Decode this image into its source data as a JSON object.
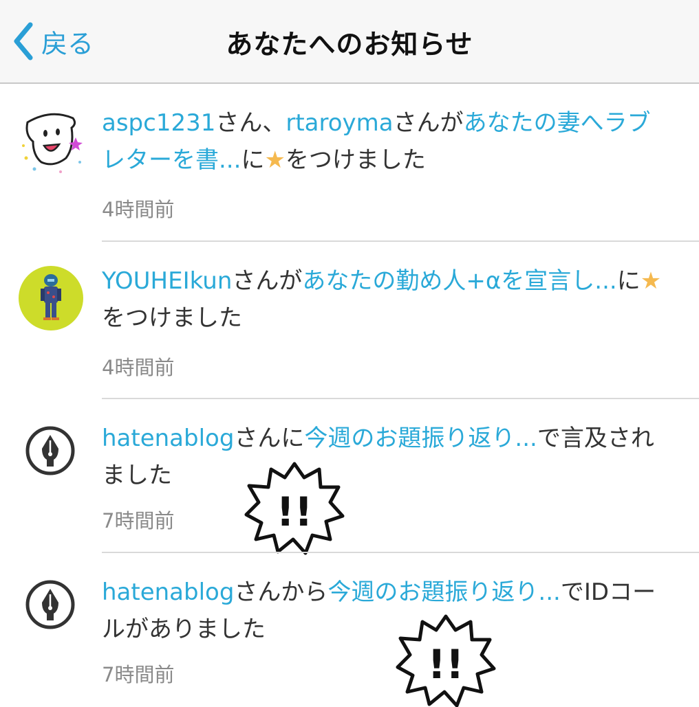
{
  "nav": {
    "back_label": "戻る",
    "title": "あなたへのお知らせ"
  },
  "colors": {
    "link": "#2aa9d8",
    "star": "#f5b94f",
    "text": "#333333",
    "time": "#8a8a8a"
  },
  "notifications": [
    {
      "avatar": "cartoon-face-icon",
      "user1": "aspc1231",
      "join1": "さん、",
      "user2": "rtaroyma",
      "join2": "さんが",
      "entry": "あなたの妻へラブレターを書...",
      "pre_star": "に",
      "star": "★",
      "suffix": "をつけました",
      "time": "4時間前"
    },
    {
      "avatar": "character-avatar-icon",
      "user1": "YOUHEIkun",
      "join1": "さんが",
      "entry": "あなたの勤め人+αを宣言し...",
      "pre_star": "に",
      "star": "★",
      "suffix": "をつけました",
      "time": "4時間前"
    },
    {
      "avatar": "pen-nib-icon",
      "user1": "hatenablog",
      "join1": "さんに",
      "entry": "今週のお題振り返り...",
      "suffix": "で言及されました",
      "time": "7時間前",
      "sticker": "!!"
    },
    {
      "avatar": "pen-nib-icon",
      "user1": "hatenablog",
      "join1": "さんから",
      "entry": "今週のお題振り返り...",
      "suffix": "でIDコールがありました",
      "time": "7時間前",
      "sticker": "!!"
    }
  ]
}
